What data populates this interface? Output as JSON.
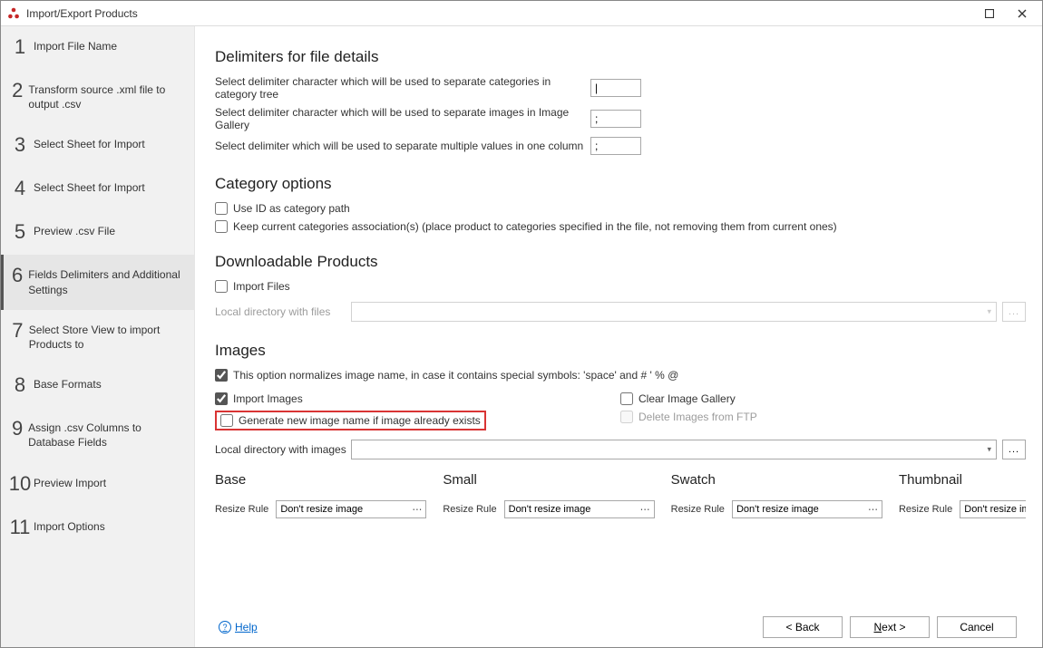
{
  "window": {
    "title": "Import/Export Products"
  },
  "sidebar": {
    "steps": [
      {
        "num": "1",
        "label": "Import File Name"
      },
      {
        "num": "2",
        "label": "Transform source .xml file to output .csv"
      },
      {
        "num": "3",
        "label": "Select Sheet for Import"
      },
      {
        "num": "4",
        "label": "Select Sheet for Import"
      },
      {
        "num": "5",
        "label": "Preview .csv File"
      },
      {
        "num": "6",
        "label": "Fields Delimiters and Additional Settings"
      },
      {
        "num": "7",
        "label": "Select Store View to import Products to"
      },
      {
        "num": "8",
        "label": "Base Formats"
      },
      {
        "num": "9",
        "label": "Assign .csv Columns to Database Fields"
      },
      {
        "num": "10",
        "label": "Preview Import"
      },
      {
        "num": "11",
        "label": "Import Options"
      }
    ],
    "active_index": 5
  },
  "section_delim": {
    "heading": "Delimiters for file details",
    "row1_label": "Select delimiter character which will be used to separate categories in category tree",
    "row1_value": "|",
    "row2_label": "Select delimiter character which will be used to separate images in Image Gallery",
    "row2_value": ";",
    "row3_label": "Select delimiter which will be used to separate multiple values in one column",
    "row3_value": ";"
  },
  "section_cat": {
    "heading": "Category options",
    "chk1": "Use ID as category path",
    "chk2": "Keep current categories association(s) (place product to categories specified in the file, not removing them from current ones)"
  },
  "section_dl": {
    "heading": "Downloadable Products",
    "chk": "Import Files",
    "path_label": "Local directory with files"
  },
  "section_img": {
    "heading": "Images",
    "chk_norm": "This option normalizes image name, in case it contains special symbols: 'space' and # ' % @",
    "chk_import": "Import Images",
    "chk_gen": "Generate new image name if image already exists",
    "chk_clear": "Clear Image Gallery",
    "chk_del_ftp": "Delete Images from FTP",
    "path_label": "Local directory with images",
    "cols": {
      "base": "Base",
      "small": "Small",
      "swatch": "Swatch",
      "thumb": "Thumbnail"
    },
    "resize_label": "Resize Rule",
    "resize_value": "Don't resize image"
  },
  "footer": {
    "help": "Help",
    "back": "< Back",
    "next": "Next >",
    "cancel": "Cancel"
  },
  "icons": {
    "ellipsis": "..."
  }
}
